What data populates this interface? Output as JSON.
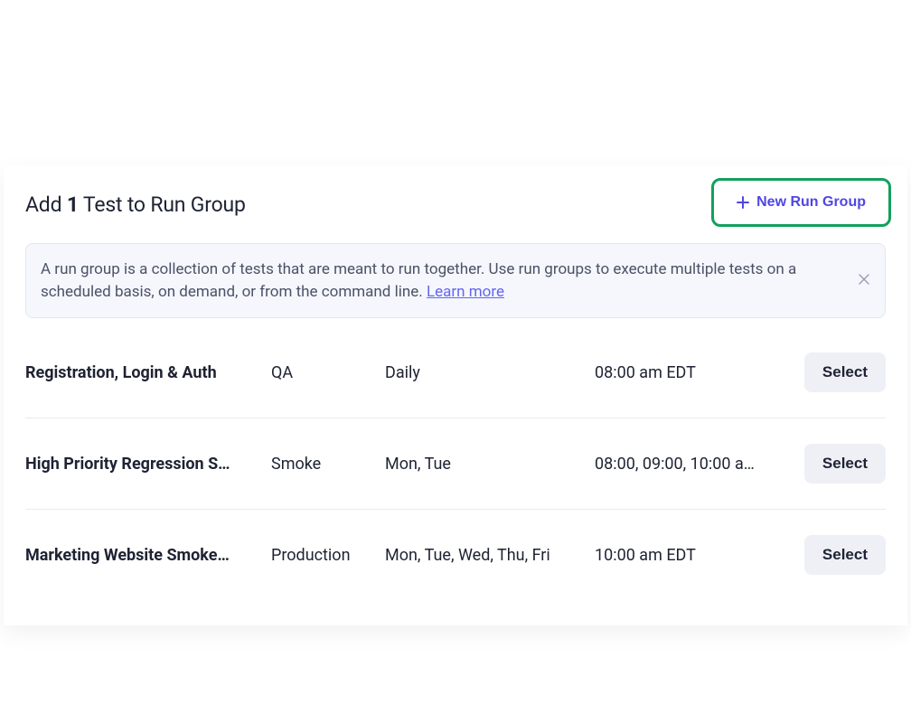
{
  "header": {
    "title_prefix": "Add ",
    "count": "1",
    "title_suffix": " Test to Run Group",
    "new_group_label": "New Run Group"
  },
  "banner": {
    "text_before_link": "A run group is a collection of tests that are meant to run together. Use run groups to execute multiple tests on a scheduled basis, on demand, or from the command line. ",
    "link_label": "Learn more"
  },
  "rows": [
    {
      "name": "Registration, Login & Auth",
      "env": "QA",
      "days": "Daily",
      "time": "08:00 am EDT",
      "action": "Select"
    },
    {
      "name": "High Priority Regression S…",
      "env": "Smoke",
      "days": "Mon, Tue",
      "time": "08:00, 09:00, 10:00 a…",
      "action": "Select"
    },
    {
      "name": "Marketing Website Smoke…",
      "env": "Production",
      "days": "Mon, Tue, Wed, Thu, Fri",
      "time": "10:00 am EDT",
      "action": "Select"
    }
  ],
  "colors": {
    "highlight_border": "#12a05c",
    "link": "#6366f1",
    "primary_text": "#1e2233"
  }
}
